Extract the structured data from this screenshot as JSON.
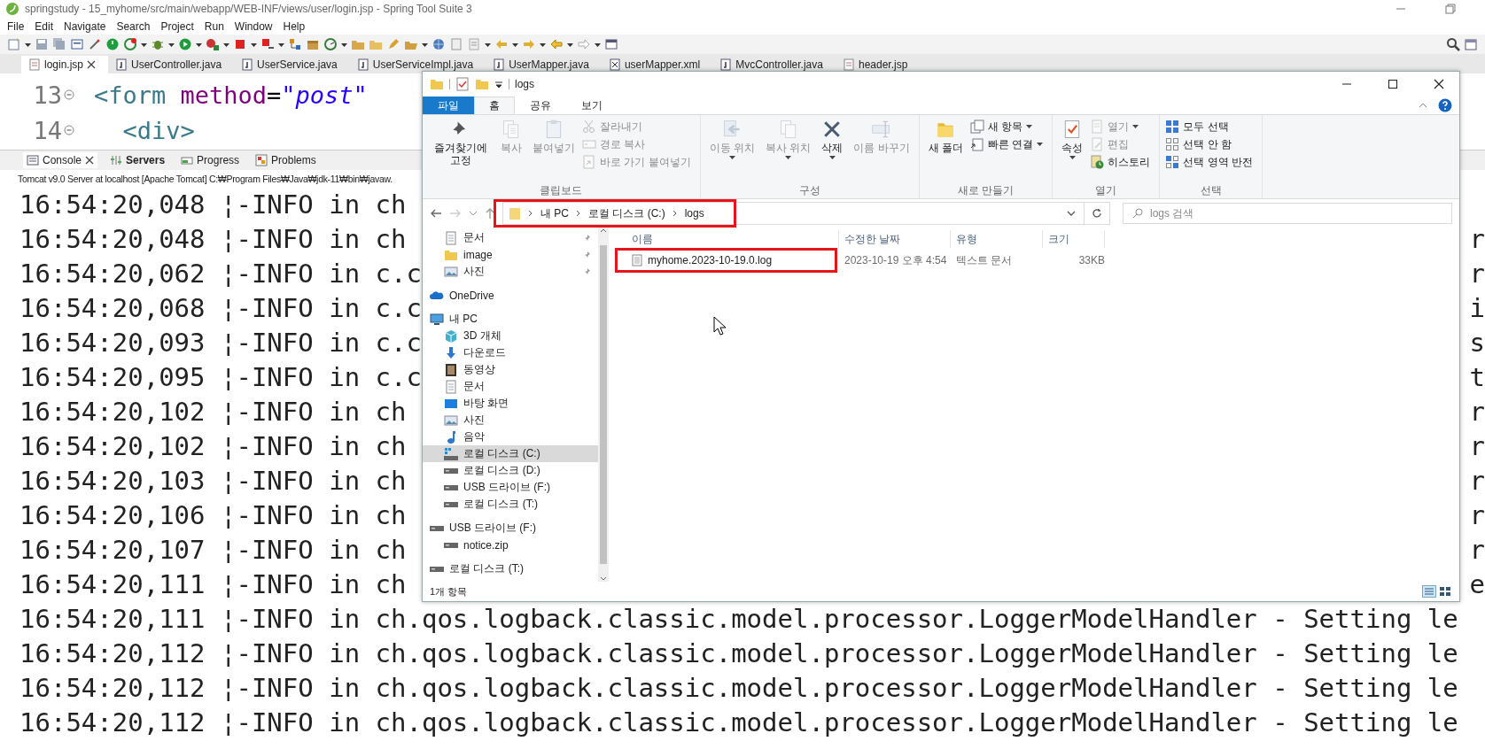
{
  "window": {
    "title": "springstudy - 15_myhome/src/main/webapp/WEB-INF/views/user/login.jsp - Spring Tool Suite 3"
  },
  "menu": [
    "File",
    "Edit",
    "Navigate",
    "Search",
    "Project",
    "Run",
    "Window",
    "Help"
  ],
  "editor_tabs": [
    {
      "label": "login.jsp",
      "selected": true,
      "kind": "jsp"
    },
    {
      "label": "UserController.java",
      "selected": false,
      "kind": "java"
    },
    {
      "label": "UserService.java",
      "selected": false,
      "kind": "java"
    },
    {
      "label": "UserServiceImpl.java",
      "selected": false,
      "kind": "java"
    },
    {
      "label": "UserMapper.java",
      "selected": false,
      "kind": "java"
    },
    {
      "label": "userMapper.xml",
      "selected": false,
      "kind": "xml"
    },
    {
      "label": "MvcController.java",
      "selected": false,
      "kind": "java"
    },
    {
      "label": "header.jsp",
      "selected": false,
      "kind": "jsp"
    }
  ],
  "editor": {
    "lines": [
      {
        "number": "13",
        "tokens": [
          {
            "kind": "tag",
            "text": "<form"
          },
          {
            "kind": "attr",
            "text": " method"
          },
          {
            "kind": "plain",
            "text": "="
          },
          {
            "kind": "string",
            "text": "\"post\""
          }
        ]
      },
      {
        "number": "14",
        "tokens": [
          {
            "kind": "tag",
            "text": "  <div>"
          }
        ]
      }
    ]
  },
  "console": {
    "tabs": [
      {
        "label": "Console",
        "selected": true
      },
      {
        "label": "Servers",
        "selected": false
      },
      {
        "label": "Progress",
        "selected": false
      },
      {
        "label": "Problems",
        "selected": false
      }
    ],
    "process": "Tomcat v9.0 Server at localhost [Apache Tomcat] C:₩Program Files₩Java₩jdk-11₩bin₩javaw.",
    "lines": [
      {
        "text": "16:54:20,048 ¦-INFO in ch"
      },
      {
        "text": "16:54:20,048 ¦-INFO in ch",
        "tail": "r"
      },
      {
        "text": "16:54:20,062 ¦-INFO in c.c",
        "tail": "r"
      },
      {
        "text": "16:54:20,068 ¦-INFO in c.c",
        "tail": "i"
      },
      {
        "text": "16:54:20,093 ¦-INFO in c.c",
        "tail": "s"
      },
      {
        "text": "16:54:20,095 ¦-INFO in c.c",
        "tail": "t"
      },
      {
        "text": "16:54:20,102 ¦-INFO in ch",
        "tail": "r"
      },
      {
        "text": "16:54:20,102 ¦-INFO in ch",
        "tail": "r"
      },
      {
        "text": "16:54:20,103 ¦-INFO in ch",
        "tail": "r"
      },
      {
        "text": "16:54:20,106 ¦-INFO in ch",
        "tail": "r"
      },
      {
        "text": "16:54:20,107 ¦-INFO in ch",
        "tail": "r"
      },
      {
        "text": "16:54:20,111 ¦-INFO in ch",
        "tail": "e"
      },
      {
        "text": "16:54:20,111 ¦-INFO in ch.qos.logback.classic.model.processor.LoggerModelHandler - Setting le"
      },
      {
        "text": "16:54:20,112 ¦-INFO in ch.qos.logback.classic.model.processor.LoggerModelHandler - Setting le"
      },
      {
        "text": "16:54:20,112 ¦-INFO in ch.qos.logback.classic.model.processor.LoggerModelHandler - Setting le"
      },
      {
        "text": "16:54:20,112 ¦-INFO in ch.qos.logback.classic.model.processor.LoggerModelHandler - Setting le"
      }
    ]
  },
  "explorer": {
    "title": "logs",
    "ribbon_tabs": [
      {
        "label": "파일",
        "kind": "file",
        "selected": false
      },
      {
        "label": "홈",
        "kind": "tab",
        "selected": true
      },
      {
        "label": "공유",
        "kind": "tab",
        "selected": false
      },
      {
        "label": "보기",
        "kind": "tab",
        "selected": false
      }
    ],
    "ribbon_groups": [
      {
        "label": "클립보드",
        "items": [
          {
            "label": "즐겨찾기에 고정",
            "kind": "large",
            "disabled": false
          },
          {
            "label": "복사",
            "kind": "large",
            "disabled": true
          },
          {
            "label": "붙여넣기",
            "kind": "large",
            "disabled": true
          },
          {
            "label": "잘라내기",
            "kind": "small",
            "disabled": true
          },
          {
            "label": "경로 복사",
            "kind": "small",
            "disabled": true
          },
          {
            "label": "바로 가기 붙여넣기",
            "kind": "small",
            "disabled": true
          }
        ]
      },
      {
        "label": "구성",
        "items": [
          {
            "label": "이동 위치",
            "kind": "large",
            "disabled": true,
            "dropdown": true
          },
          {
            "label": "복사 위치",
            "kind": "large",
            "disabled": true,
            "dropdown": true
          },
          {
            "label": "삭제",
            "kind": "large",
            "disabled": false,
            "dropdown": true
          },
          {
            "label": "이름 바꾸기",
            "kind": "large",
            "disabled": true
          }
        ]
      },
      {
        "label": "새로 만들기",
        "items": [
          {
            "label": "새 폴더",
            "kind": "large",
            "disabled": false
          },
          {
            "label": "새 항목",
            "kind": "small",
            "disabled": false,
            "dropdown": true
          },
          {
            "label": "빠른 연결",
            "kind": "small",
            "disabled": false,
            "dropdown": true
          }
        ]
      },
      {
        "label": "열기",
        "items": [
          {
            "label": "속성",
            "kind": "large",
            "disabled": false,
            "dropdown": true
          },
          {
            "label": "열기",
            "kind": "small",
            "disabled": true,
            "dropdown": true
          },
          {
            "label": "편집",
            "kind": "small",
            "disabled": true
          },
          {
            "label": "히스토리",
            "kind": "small",
            "disabled": false
          }
        ]
      },
      {
        "label": "선택",
        "items": [
          {
            "label": "모두 선택",
            "kind": "small",
            "disabled": false
          },
          {
            "label": "선택 안 함",
            "kind": "small",
            "disabled": false
          },
          {
            "label": "선택 영역 반전",
            "kind": "small",
            "disabled": false
          }
        ]
      }
    ],
    "breadcrumbs": [
      "내 PC",
      "로컬 디스크 (C:)",
      "logs"
    ],
    "search": {
      "placeholder": "logs 검색"
    },
    "nav": [
      {
        "label": "문서",
        "pinned": true,
        "selected": false
      },
      {
        "label": "image",
        "pinned": true,
        "selected": false
      },
      {
        "label": "사진",
        "pinned": true,
        "selected": false
      },
      {
        "label": "OneDrive",
        "pinned": false,
        "selected": false
      },
      {
        "label": "내 PC",
        "pinned": false,
        "selected": false,
        "children": [
          {
            "label": "3D 개체",
            "selected": false
          },
          {
            "label": "다운로드",
            "selected": false
          },
          {
            "label": "동영상",
            "selected": false
          },
          {
            "label": "문서",
            "selected": false
          },
          {
            "label": "바탕 화면",
            "selected": false
          },
          {
            "label": "사진",
            "selected": false
          },
          {
            "label": "음악",
            "selected": false
          },
          {
            "label": "로컬 디스크 (C:)",
            "selected": true
          },
          {
            "label": "로컬 디스크 (D:)",
            "selected": false
          },
          {
            "label": "USB 드라이브 (F:)",
            "selected": false
          },
          {
            "label": "로컬 디스크 (T:)",
            "selected": false
          }
        ]
      },
      {
        "label": "USB 드라이브 (F:)",
        "pinned": false,
        "selected": false,
        "children": [
          {
            "label": "notice.zip",
            "selected": false
          }
        ]
      },
      {
        "label": "로컬 디스크 (T:)",
        "pinned": false,
        "selected": false
      }
    ],
    "columns": [
      "이름",
      "수정한 날짜",
      "유형",
      "크기"
    ],
    "files": [
      {
        "name": "myhome.2023-10-19.0.log",
        "date": "2023-10-19 오후 4:54",
        "type": "텍스트 문서",
        "size": "33KB",
        "selected": false
      }
    ],
    "status": "1개 항목"
  }
}
